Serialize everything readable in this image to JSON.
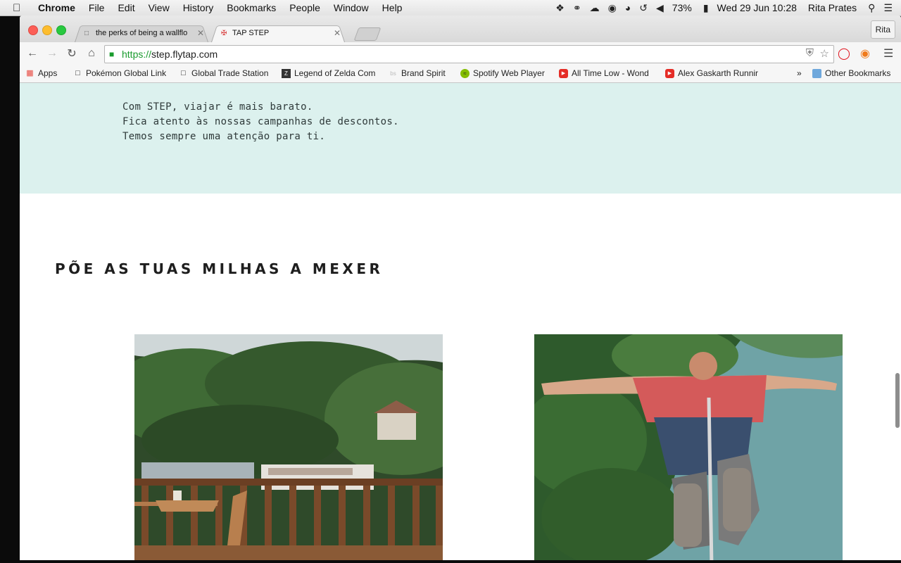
{
  "menubar": {
    "app": "Chrome",
    "items": [
      "File",
      "Edit",
      "View",
      "History",
      "Bookmarks",
      "People",
      "Window",
      "Help"
    ],
    "battery": "73%",
    "datetime": "Wed 29 Jun  10:28",
    "user": "Rita Prates"
  },
  "tabs": [
    {
      "title": "the perks of being a wallflo",
      "active": false
    },
    {
      "title": "TAP STEP",
      "active": true
    }
  ],
  "profile_button": "Rita",
  "address": {
    "scheme": "https://",
    "host": "step.flytap.com"
  },
  "bookmarks": [
    {
      "label": "Apps",
      "icon": "apps-grid-icon"
    },
    {
      "label": "Pokémon Global Link",
      "icon": "page-icon"
    },
    {
      "label": "Global Trade Station",
      "icon": "page-icon"
    },
    {
      "label": "Legend of Zelda Com",
      "icon": "zelda-icon"
    },
    {
      "label": "Brand Spirit",
      "icon": "bs-icon"
    },
    {
      "label": "Spotify Web Player",
      "icon": "spotify-icon"
    },
    {
      "label": "All Time Low - Wond",
      "icon": "youtube-icon"
    },
    {
      "label": "Alex Gaskarth Runnir",
      "icon": "youtube-icon"
    },
    {
      "label": "»",
      "icon": "overflow-icon"
    },
    {
      "label": "Other Bookmarks",
      "icon": "folder-icon"
    }
  ],
  "page": {
    "promo_lines": [
      "Com STEP, viajar é mais barato.",
      "Fica atento às nossas campanhas de descontos.",
      "Temos sempre uma atenção para ti."
    ],
    "section_title": "PÕE AS TUAS MILHAS A MEXER"
  },
  "colors": {
    "promo_bg": "#dcf1ee",
    "secure_green": "#1a9b2e"
  }
}
